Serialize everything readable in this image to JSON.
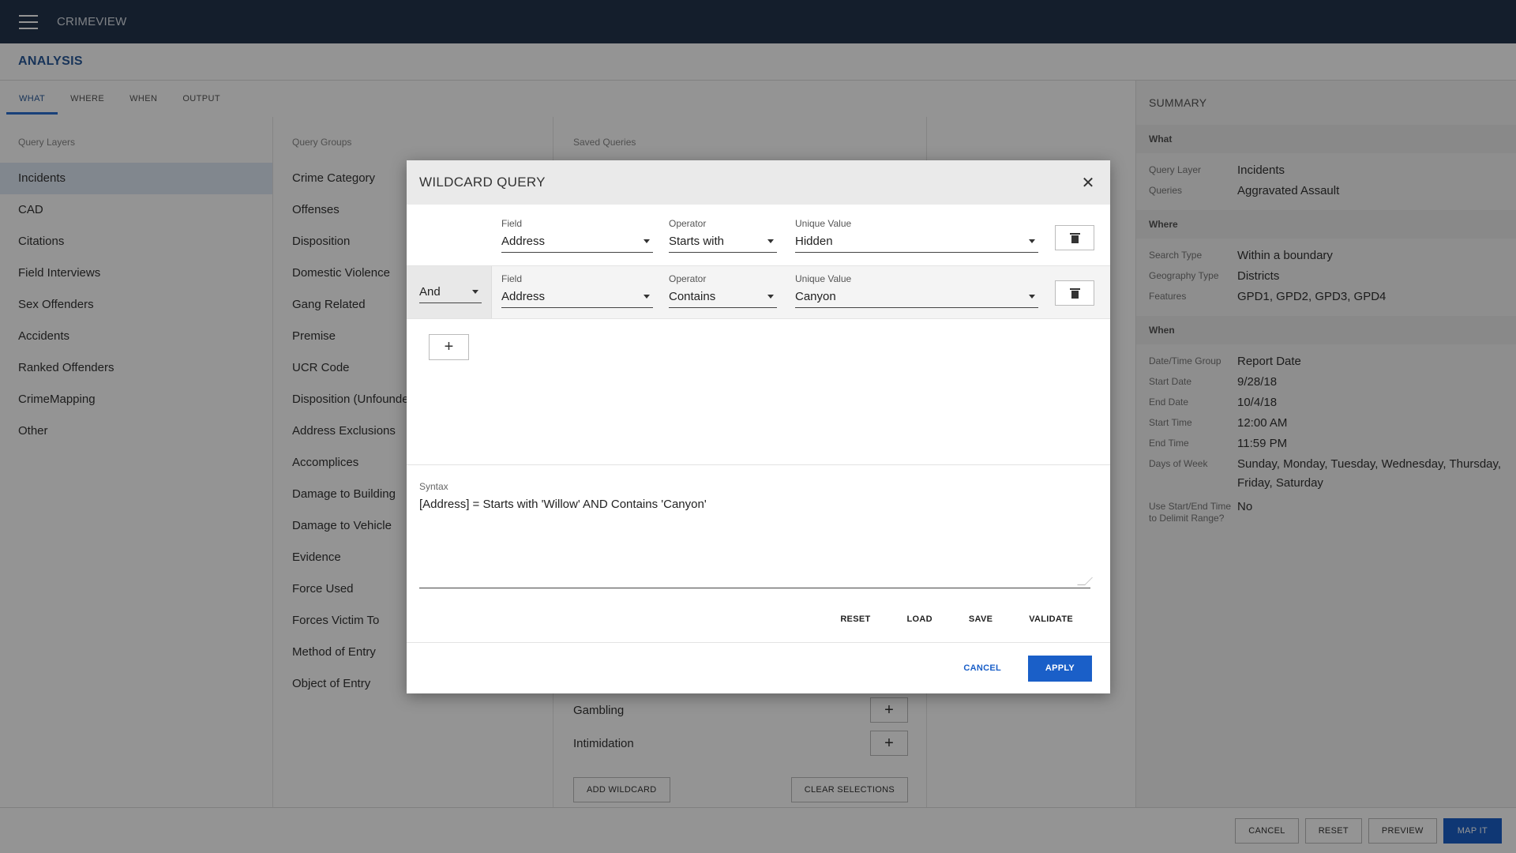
{
  "app": {
    "title": "CRIMEVIEW"
  },
  "analysis": {
    "title": "ANALYSIS"
  },
  "tabs": [
    {
      "label": "WHAT"
    },
    {
      "label": "WHERE"
    },
    {
      "label": "WHEN"
    },
    {
      "label": "OUTPUT"
    }
  ],
  "query_layers": {
    "heading": "Query Layers",
    "items": [
      "Incidents",
      "CAD",
      "Citations",
      "Field Interviews",
      "Sex Offenders",
      "Accidents",
      "Ranked Offenders",
      "CrimeMapping",
      "Other"
    ],
    "selected": "Incidents"
  },
  "query_groups": {
    "heading": "Query Groups",
    "items": [
      "Crime Category",
      "Offenses",
      "Disposition",
      "Domestic Violence",
      "Gang Related",
      "Premise",
      "UCR Code",
      "Disposition (Unfounde",
      "Address Exclusions",
      "Accomplices",
      "Damage to Building",
      "Damage to Vehicle",
      "Evidence",
      "Force Used",
      "Forces Victim To",
      "Method of Entry",
      "Object of Entry"
    ]
  },
  "saved_queries": {
    "heading": "Saved Queries",
    "visible_items": [
      "Gambling",
      "Intimidation"
    ],
    "add_wildcard": "ADD WILDCARD",
    "clear_selections": "CLEAR SELECTIONS"
  },
  "summary": {
    "title": "SUMMARY",
    "what": {
      "heading": "What",
      "query_layer_label": "Query Layer",
      "query_layer": "Incidents",
      "queries_label": "Queries",
      "queries": "Aggravated Assault"
    },
    "where": {
      "heading": "Where",
      "search_type_label": "Search Type",
      "search_type": "Within a boundary",
      "geography_type_label": "Geography Type",
      "geography_type": "Districts",
      "features_label": "Features",
      "features": "GPD1, GPD2, GPD3, GPD4"
    },
    "when": {
      "heading": "When",
      "group_label": "Date/Time Group",
      "group": "Report Date",
      "start_date_label": "Start Date",
      "start_date": "9/28/18",
      "end_date_label": "End Date",
      "end_date": "10/4/18",
      "start_time_label": "Start Time",
      "start_time": "12:00 AM",
      "end_time_label": "End Time",
      "end_time": "11:59 PM",
      "days_label": "Days of Week",
      "days": "Sunday, Monday, Tuesday, Wednesday, Thursday, Friday, Saturday",
      "delimit_label": "Use Start/End Time to Delimit Range?",
      "delimit": "No"
    }
  },
  "bottom_bar": {
    "cancel": "CANCEL",
    "reset": "RESET",
    "preview": "PREVIEW",
    "map_it": "MAP IT"
  },
  "modal": {
    "title": "WILDCARD QUERY",
    "rows": [
      {
        "field_label": "Field",
        "field": "Address",
        "operator_label": "Operator",
        "operator": "Starts with",
        "value_label": "Unique Value",
        "value": "Hidden"
      },
      {
        "conjunction": "And",
        "field_label": "Field",
        "field": "Address",
        "operator_label": "Operator",
        "operator": "Contains",
        "value_label": "Unique Value",
        "value": "Canyon"
      }
    ],
    "syntax_label": "Syntax",
    "syntax": "[Address] = Starts with 'Willow' AND Contains 'Canyon'",
    "reset": "RESET",
    "load": "LOAD",
    "save": "SAVE",
    "validate": "VALIDATE",
    "cancel": "CANCEL",
    "apply": "APPLY"
  },
  "colors": {
    "topbar": "#23344d",
    "accent": "#1a5fc8",
    "overlay": "rgba(0,0,0,0.42)"
  }
}
